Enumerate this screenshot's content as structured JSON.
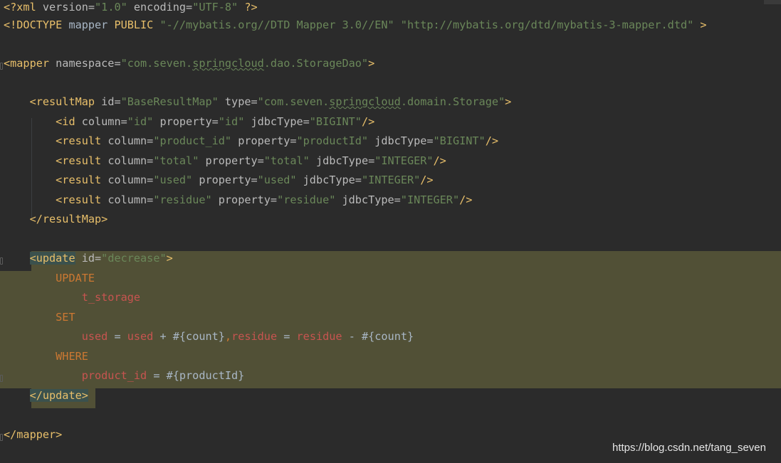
{
  "editor": {
    "lines": [
      {
        "tokens": [
          [
            "tag",
            "<?xml "
          ],
          [
            "attr",
            "version="
          ],
          [
            "str",
            "\"1.0\""
          ],
          [
            "attr",
            " encoding="
          ],
          [
            "str",
            "\"UTF-8\""
          ],
          [
            "tag",
            " ?>"
          ]
        ]
      },
      {
        "tokens": [
          [
            "tag",
            "<!DOCTYPE "
          ],
          [
            "txt",
            "mapper "
          ],
          [
            "tag",
            "PUBLIC "
          ],
          [
            "str",
            "\"-//mybatis.org//DTD Mapper 3.0//EN\""
          ],
          [
            "txt",
            " "
          ],
          [
            "str",
            "\"http://mybatis.org/dtd/mybatis-3-mapper.dtd\""
          ],
          [
            "tag",
            " >"
          ]
        ]
      },
      {
        "tokens": []
      },
      {
        "tokens": [
          [
            "tag",
            "<mapper "
          ],
          [
            "attr",
            "namespace="
          ],
          [
            "str",
            "\"com.seven."
          ],
          [
            "str typo",
            "springcloud"
          ],
          [
            "str",
            ".dao.StorageDao\""
          ],
          [
            "tag",
            ">"
          ]
        ]
      },
      {
        "tokens": []
      },
      {
        "tokens": [
          [
            "txt",
            "    "
          ],
          [
            "tag",
            "<resultMap "
          ],
          [
            "attr",
            "id="
          ],
          [
            "str",
            "\"BaseResultMap\""
          ],
          [
            "attr",
            " type="
          ],
          [
            "str",
            "\"com.seven."
          ],
          [
            "str typo",
            "springcloud"
          ],
          [
            "str",
            ".domain.Storage\""
          ],
          [
            "tag",
            ">"
          ]
        ]
      },
      {
        "tokens": [
          [
            "txt",
            "        "
          ],
          [
            "tag",
            "<id "
          ],
          [
            "attr",
            "column="
          ],
          [
            "str",
            "\"id\""
          ],
          [
            "attr",
            " property="
          ],
          [
            "str",
            "\"id\""
          ],
          [
            "attr",
            " jdbcType="
          ],
          [
            "str",
            "\"BIGINT\""
          ],
          [
            "tag",
            "/>"
          ]
        ]
      },
      {
        "tokens": [
          [
            "txt",
            "        "
          ],
          [
            "tag",
            "<result "
          ],
          [
            "attr",
            "column="
          ],
          [
            "str",
            "\"product_id\""
          ],
          [
            "attr",
            " property="
          ],
          [
            "str",
            "\"productId\""
          ],
          [
            "attr",
            " jdbcType="
          ],
          [
            "str",
            "\"BIGINT\""
          ],
          [
            "tag",
            "/>"
          ]
        ]
      },
      {
        "tokens": [
          [
            "txt",
            "        "
          ],
          [
            "tag",
            "<result "
          ],
          [
            "attr",
            "column="
          ],
          [
            "str",
            "\"total\""
          ],
          [
            "attr",
            " property="
          ],
          [
            "str",
            "\"total\""
          ],
          [
            "attr",
            " jdbcType="
          ],
          [
            "str",
            "\"INTEGER\""
          ],
          [
            "tag",
            "/>"
          ]
        ]
      },
      {
        "tokens": [
          [
            "txt",
            "        "
          ],
          [
            "tag",
            "<result "
          ],
          [
            "attr",
            "column="
          ],
          [
            "str",
            "\"used\""
          ],
          [
            "attr",
            " property="
          ],
          [
            "str",
            "\"used\""
          ],
          [
            "attr",
            " jdbcType="
          ],
          [
            "str",
            "\"INTEGER\""
          ],
          [
            "tag",
            "/>"
          ]
        ]
      },
      {
        "tokens": [
          [
            "txt",
            "        "
          ],
          [
            "tag",
            "<result "
          ],
          [
            "attr",
            "column="
          ],
          [
            "str",
            "\"residue\""
          ],
          [
            "attr",
            " property="
          ],
          [
            "str",
            "\"residue\""
          ],
          [
            "attr",
            " jdbcType="
          ],
          [
            "str",
            "\"INTEGER\""
          ],
          [
            "tag",
            "/>"
          ]
        ]
      },
      {
        "tokens": [
          [
            "txt",
            "    "
          ],
          [
            "tag",
            "</resultMap>"
          ]
        ]
      },
      {
        "tokens": []
      },
      {
        "tokens": [
          [
            "txt",
            "    "
          ],
          [
            "tag match",
            "<update"
          ],
          [
            "attr",
            " id="
          ],
          [
            "str",
            "\"decrease\""
          ],
          [
            "tag",
            ">"
          ]
        ]
      },
      {
        "tokens": [
          [
            "txt",
            "        "
          ],
          [
            "kw",
            "UPDATE"
          ]
        ]
      },
      {
        "tokens": [
          [
            "txt",
            "            "
          ],
          [
            "sqlid",
            "t_storage"
          ]
        ]
      },
      {
        "tokens": [
          [
            "txt",
            "        "
          ],
          [
            "kw",
            "SET"
          ]
        ]
      },
      {
        "tokens": [
          [
            "txt",
            "            "
          ],
          [
            "sqlid",
            "used"
          ],
          [
            "txt",
            " = "
          ],
          [
            "sqlid",
            "used"
          ],
          [
            "txt",
            " + #{count}"
          ],
          [
            "kw",
            ","
          ],
          [
            "sqlid",
            "residue"
          ],
          [
            "txt",
            " = "
          ],
          [
            "sqlid",
            "residue"
          ],
          [
            "txt",
            " - #{count}"
          ]
        ]
      },
      {
        "tokens": [
          [
            "txt",
            "        "
          ],
          [
            "kw",
            "WHERE"
          ]
        ]
      },
      {
        "tokens": [
          [
            "txt",
            "            "
          ],
          [
            "sqlid",
            "product_id"
          ],
          [
            "txt",
            " = #{productId}"
          ]
        ]
      },
      {
        "tokens": [
          [
            "txt",
            "    "
          ],
          [
            "tag match",
            "</update>"
          ]
        ]
      },
      {
        "tokens": []
      },
      {
        "tokens": [
          [
            "tag",
            "</mapper>"
          ]
        ]
      }
    ]
  },
  "watermark": "https://blog.csdn.net/tang_seven"
}
